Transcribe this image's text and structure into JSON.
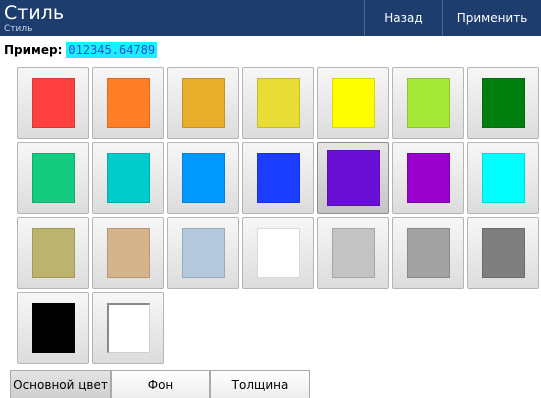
{
  "header": {
    "title": "Стиль",
    "subtitle": "Стиль",
    "back_label": "Назад",
    "apply_label": "Применить",
    "background_color": "#1c3d6e"
  },
  "example": {
    "label": "Пример:",
    "value": "012345.64789",
    "highlight_color": "#19f0ff",
    "text_color": "#2a4fd0"
  },
  "palette": {
    "selected_index": 11,
    "colors": [
      "#ff4040",
      "#ff7f27",
      "#e8ad2a",
      "#e8dc36",
      "#ffff00",
      "#a6e837",
      "#007f0e",
      "#14cc80",
      "#00cccc",
      "#0099ff",
      "#1a3dff",
      "#6a0fd4",
      "#9900cc",
      "#00ffff",
      "#bcb36f",
      "#d5b48c",
      "#b4c8de",
      "#ffffff",
      "#c3c3c3",
      "#a2a2a2",
      "#7f7f7f",
      "#000000",
      "none"
    ]
  },
  "tabs": [
    {
      "label": "Основной цвет",
      "active": true
    },
    {
      "label": "Фон",
      "active": false
    },
    {
      "label": "Толщина",
      "active": false
    }
  ]
}
